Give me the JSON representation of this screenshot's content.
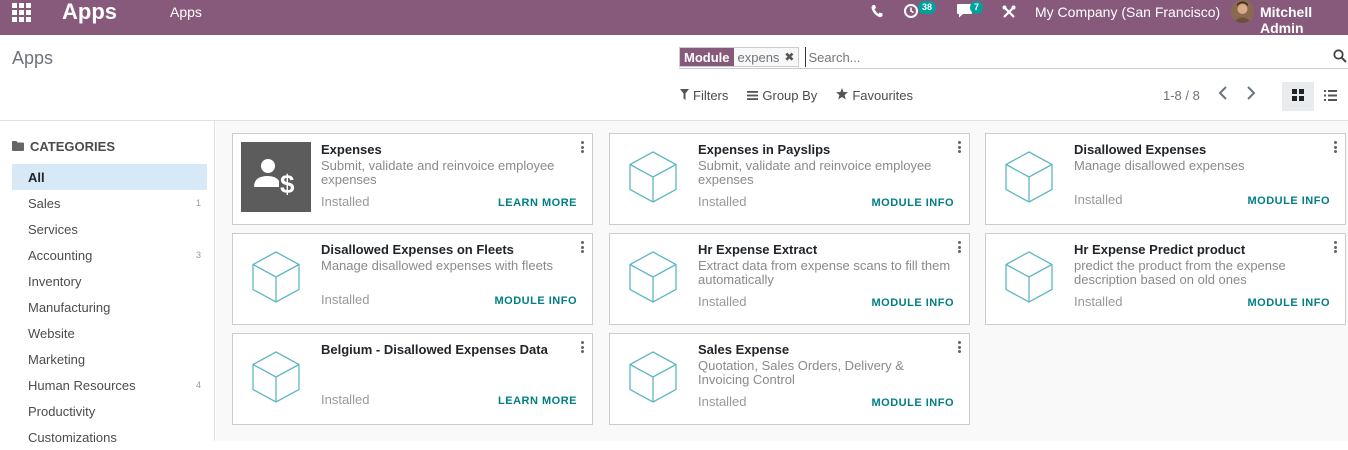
{
  "navbar": {
    "brand": "Apps",
    "menu_item": "Apps",
    "activity_count": "38",
    "messages_count": "7",
    "company": "My Company (San Francisco)",
    "user": "Mitchell Admin",
    "bg_color": "#875a7b",
    "icons": [
      "apps-grid-icon",
      "phone-icon",
      "activity-clock-icon",
      "chat-icon",
      "debug-tools-icon"
    ]
  },
  "control_panel": {
    "breadcrumb": "Apps",
    "search": {
      "facet_label": "Module",
      "facet_value": "expens",
      "placeholder": "Search..."
    },
    "filters_label": "Filters",
    "group_by_label": "Group By",
    "favourites_label": "Favourites",
    "pager": "1-8 / 8",
    "active_view": "kanban"
  },
  "sidebar": {
    "heading": "CATEGORIES",
    "items": [
      {
        "label": "All",
        "count": "",
        "active": true
      },
      {
        "label": "Sales",
        "count": "1"
      },
      {
        "label": "Services",
        "count": ""
      },
      {
        "label": "Accounting",
        "count": "3"
      },
      {
        "label": "Inventory",
        "count": ""
      },
      {
        "label": "Manufacturing",
        "count": ""
      },
      {
        "label": "Website",
        "count": ""
      },
      {
        "label": "Marketing",
        "count": ""
      },
      {
        "label": "Human Resources",
        "count": "4"
      },
      {
        "label": "Productivity",
        "count": ""
      },
      {
        "label": "Customizations",
        "count": ""
      }
    ]
  },
  "apps": [
    {
      "title": "Expenses",
      "desc": "Submit, validate and reinvoice employee expenses",
      "status": "Installed",
      "action": "LEARN MORE",
      "icon": "expenses-app-icon"
    },
    {
      "title": "Expenses in Payslips",
      "desc": "Submit, validate and reinvoice employee expenses",
      "status": "Installed",
      "action": "MODULE INFO",
      "icon": "module-cube-icon"
    },
    {
      "title": "Disallowed Expenses",
      "desc": "Manage disallowed expenses",
      "status": "Installed",
      "action": "MODULE INFO",
      "icon": "module-cube-icon"
    },
    {
      "title": "Disallowed Expenses on Fleets",
      "desc": "Manage disallowed expenses with fleets",
      "status": "Installed",
      "action": "MODULE INFO",
      "icon": "module-cube-icon"
    },
    {
      "title": "Hr Expense Extract",
      "desc": "Extract data from expense scans to fill them automatically",
      "status": "Installed",
      "action": "MODULE INFO",
      "icon": "module-cube-icon"
    },
    {
      "title": "Hr Expense Predict product",
      "desc": "predict the product from the expense description based on old ones",
      "status": "Installed",
      "action": "MODULE INFO",
      "icon": "module-cube-icon"
    },
    {
      "title": "Belgium - Disallowed Expenses Data",
      "desc": "",
      "status": "Installed",
      "action": "LEARN MORE",
      "icon": "module-cube-icon"
    },
    {
      "title": "Sales Expense",
      "desc": "Quotation, Sales Orders, Delivery & Invoicing Control",
      "status": "Installed",
      "action": "MODULE INFO",
      "icon": "module-cube-icon"
    }
  ]
}
